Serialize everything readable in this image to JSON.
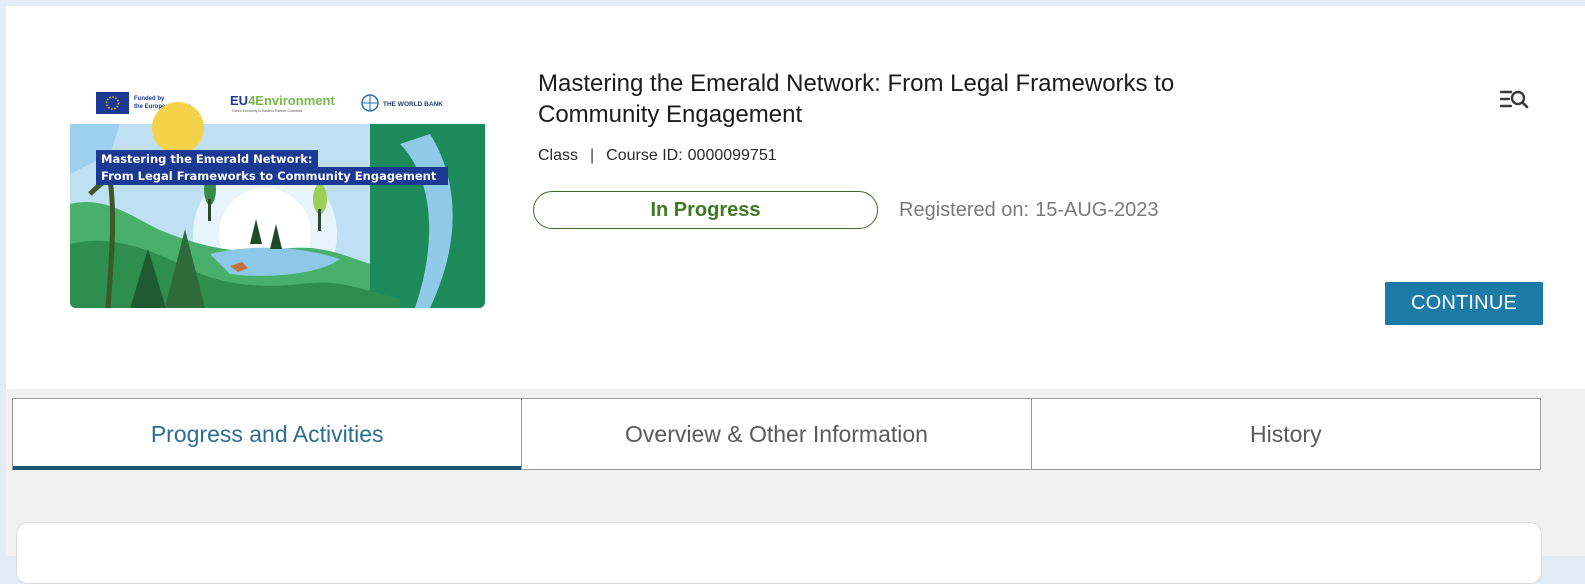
{
  "course": {
    "title": "Mastering the Emerald Network: From Legal Frameworks to Community Engagement",
    "type": "Class",
    "separator": "|",
    "course_id_label": "Course ID:",
    "course_id": "0000099751",
    "status": "In Progress",
    "registered_label": "Registered on:",
    "registered_date": "15-AUG-2023",
    "continue_label": "CONTINUE"
  },
  "thumbnail": {
    "funded_line1": "Funded by",
    "funded_line2": "the European Union",
    "eu4_prefix": "EU",
    "eu4_num": "4",
    "eu4_suffix": "Environment",
    "eu4_tagline": "Green Economy in Eastern Partner Countries",
    "worldbank": "THE WORLD BANK",
    "banner_line1": "Mastering the Emerald Network:",
    "banner_line2": "From Legal Frameworks to Community Engagement"
  },
  "tabs": [
    {
      "label": "Progress and Activities",
      "active": true
    },
    {
      "label": "Overview & Other Information",
      "active": false
    },
    {
      "label": "History",
      "active": false
    }
  ],
  "colors": {
    "accent": "#1b7ba6",
    "status_green": "#3f7a22",
    "tab_active": "#2c6e8f"
  },
  "icons": {
    "search": "list-search-icon"
  }
}
